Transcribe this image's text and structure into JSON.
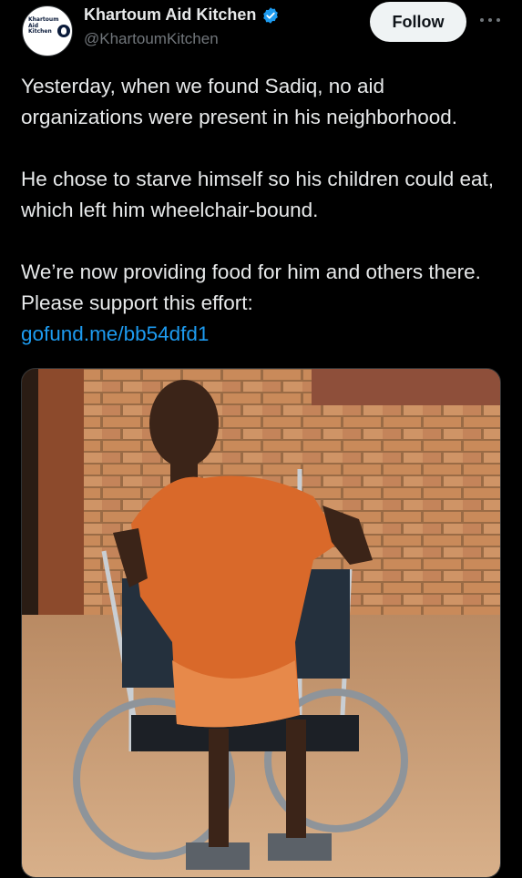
{
  "account": {
    "display_name": "Khartoum Aid Kitchen",
    "handle": "@KhartoumKitchen",
    "avatar_text": "Khartoum Aid Kitchen",
    "verified": true
  },
  "actions": {
    "follow_label": "Follow",
    "more_icon": "more-horizontal-icon"
  },
  "tweet": {
    "paragraph_1": "Yesterday, when we found Sadiq, no aid organizations were present in his neighborhood.",
    "paragraph_2": "He chose to starve himself so his children could eat, which left him wheelchair-bound.",
    "paragraph_3": "We’re now providing food for him and others there. Please support this effort:",
    "link_text": "gofund.me/bb54dfd1"
  },
  "colors": {
    "background": "#000000",
    "text": "#e7e9ea",
    "secondary_text": "#71767b",
    "link": "#1d9bf0",
    "verified_badge": "#1d9bf0",
    "follow_button_bg": "#eff3f4"
  }
}
